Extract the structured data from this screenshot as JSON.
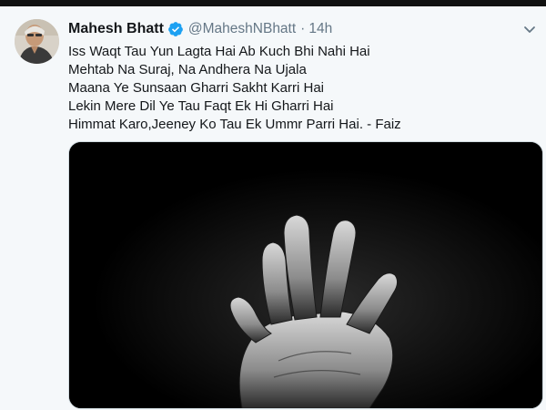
{
  "tweet": {
    "author_name": "Mahesh Bhatt",
    "handle": "@MaheshNBhatt",
    "separator": "·",
    "time": "14h",
    "verified": true,
    "text_lines": [
      "Iss Waqt Tau Yun Lagta Hai Ab Kuch Bhi Nahi Hai",
      "Mehtab Na Suraj, Na Andhera Na Ujala",
      "Maana Ye Sunsaan Gharri Sakht Karri Hai",
      "Lekin Mere Dil Ye Tau Faqt Ek Hi Gharri Hai",
      "Himmat Karo,Jeeney Ko Tau Ek Ummr Parri Hai. - Faiz"
    ],
    "icons": {
      "verified": "verified-badge-icon",
      "more": "chevron-down-icon"
    }
  },
  "colors": {
    "text": "#14171a",
    "secondary": "#657786",
    "verified": "#1da1f2",
    "media_background": "#000000",
    "card_background": "#f5f8fa"
  }
}
